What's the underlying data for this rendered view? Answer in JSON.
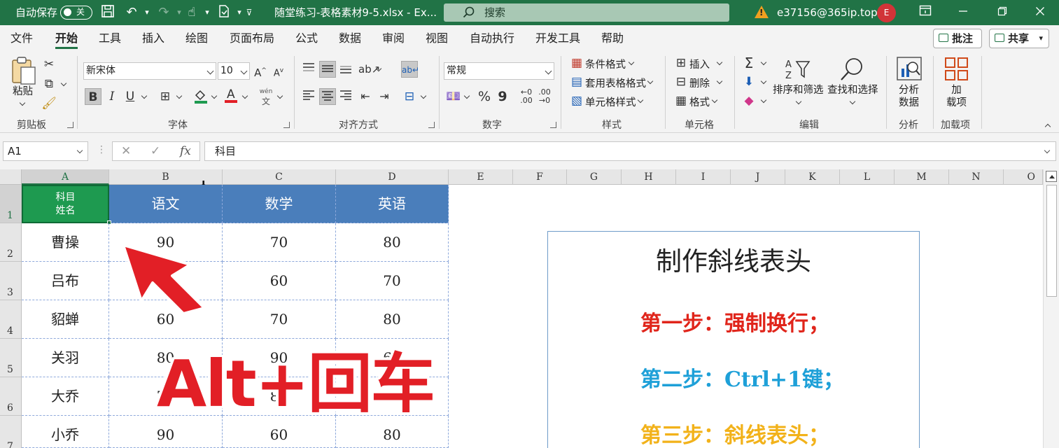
{
  "titlebar": {
    "autosave_label": "自动保存",
    "autosave_state": "关",
    "filename": "随堂练习-表格素材9-5.xlsx  -  Ex...",
    "search_placeholder": "搜索",
    "user_email": "e37156@365ip.top",
    "avatar_initial": "E"
  },
  "tabs": [
    "文件",
    "开始",
    "工具",
    "插入",
    "绘图",
    "页面布局",
    "公式",
    "数据",
    "审阅",
    "视图",
    "自动执行",
    "开发工具",
    "帮助"
  ],
  "active_tab": "开始",
  "tab_buttons": {
    "comments": "批注",
    "share": "共享"
  },
  "ribbon": {
    "clipboard": {
      "paste": "粘贴",
      "label": "剪贴板"
    },
    "font": {
      "name": "新宋体",
      "size": "10",
      "label": "字体",
      "bold": "B",
      "italic": "I",
      "underline": "U",
      "wen": "wén"
    },
    "alignment": {
      "label": "对齐方式"
    },
    "number": {
      "format": "常规",
      "label": "数字"
    },
    "styles": {
      "conditional": "条件格式",
      "table": "套用表格格式",
      "cell": "单元格样式",
      "label": "样式"
    },
    "cells": {
      "insert": "插入",
      "delete": "删除",
      "format": "格式",
      "label": "单元格"
    },
    "editing": {
      "sort": "排序和筛选",
      "find": "查找和选择",
      "label": "编辑"
    },
    "analysis": {
      "btn_line1": "分析",
      "btn_line2": "数据",
      "label": "分析"
    },
    "addins": {
      "btn_line1": "加",
      "btn_line2": "载项",
      "label": "加载项"
    }
  },
  "formula_bar": {
    "name_box": "A1",
    "fx": "fx",
    "content": "科目"
  },
  "columns": [
    "A",
    "B",
    "C",
    "D",
    "E",
    "F",
    "G",
    "H",
    "I",
    "J",
    "K",
    "L",
    "M",
    "N",
    "O"
  ],
  "rows": [
    "1",
    "2",
    "3",
    "4",
    "5",
    "6",
    "7"
  ],
  "table": {
    "header_a_top": "科目",
    "header_a_bottom": "姓名",
    "headers": [
      "语文",
      "数学",
      "英语"
    ],
    "body": [
      [
        "曹操",
        "90",
        "70",
        "80"
      ],
      [
        "吕布",
        "",
        "60",
        "70"
      ],
      [
        "貂蝉",
        "60",
        "70",
        "80"
      ],
      [
        "关羽",
        "80",
        "90",
        "60"
      ],
      [
        "大乔",
        "70",
        "80",
        "90"
      ],
      [
        "小乔",
        "90",
        "60",
        "80"
      ]
    ]
  },
  "textbox": {
    "title": "制作斜线表头",
    "steps": [
      {
        "text": "第一步：强制换行；",
        "color": "#e0251b"
      },
      {
        "text": "第二步：Ctrl+1键；",
        "color": "#1ea0d8"
      },
      {
        "text": "第三步：斜线表头；",
        "color": "#f2b21a"
      }
    ]
  },
  "overlay": {
    "big_text": "Alt+回车",
    "accent": "#e21f26"
  }
}
